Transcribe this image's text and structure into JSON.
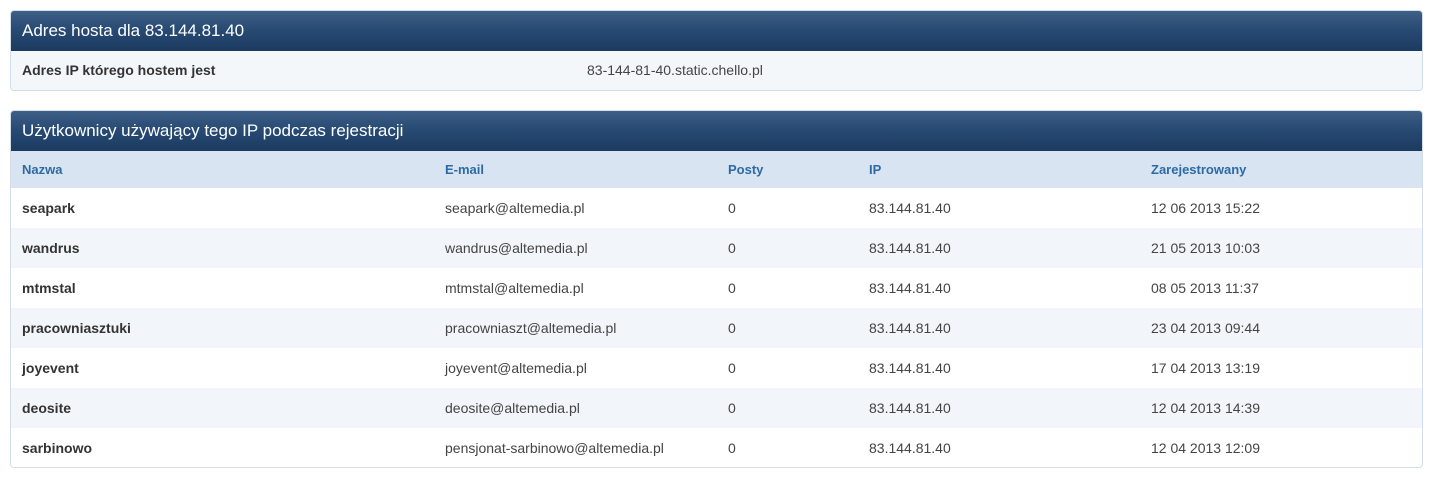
{
  "host_panel": {
    "title": "Adres hosta dla 83.144.81.40",
    "label": "Adres IP którego hostem jest",
    "value": "83-144-81-40.static.chello.pl"
  },
  "users_panel": {
    "title": "Użytkownicy używający tego IP podczas rejestracji",
    "columns": [
      "Nazwa",
      "E-mail",
      "Posty",
      "IP",
      "Zarejestrowany"
    ],
    "rows": [
      {
        "name": "seapark",
        "email": "seapark@altemedia.pl",
        "posts": "0",
        "ip": "83.144.81.40",
        "registered": "12 06 2013 15:22"
      },
      {
        "name": "wandrus",
        "email": "wandrus@altemedia.pl",
        "posts": "0",
        "ip": "83.144.81.40",
        "registered": "21 05 2013 10:03"
      },
      {
        "name": "mtmstal",
        "email": "mtmstal@altemedia.pl",
        "posts": "0",
        "ip": "83.144.81.40",
        "registered": "08 05 2013 11:37"
      },
      {
        "name": "pracowniasztuki",
        "email": "pracowniaszt@altemedia.pl",
        "posts": "0",
        "ip": "83.144.81.40",
        "registered": "23 04 2013 09:44"
      },
      {
        "name": "joyevent",
        "email": "joyevent@altemedia.pl",
        "posts": "0",
        "ip": "83.144.81.40",
        "registered": "17 04 2013 13:19"
      },
      {
        "name": "deosite",
        "email": "deosite@altemedia.pl",
        "posts": "0",
        "ip": "83.144.81.40",
        "registered": "12 04 2013 14:39"
      },
      {
        "name": "sarbinowo",
        "email": "pensjonat-sarbinowo@altemedia.pl",
        "posts": "0",
        "ip": "83.144.81.40",
        "registered": "12 04 2013 12:09"
      }
    ]
  }
}
